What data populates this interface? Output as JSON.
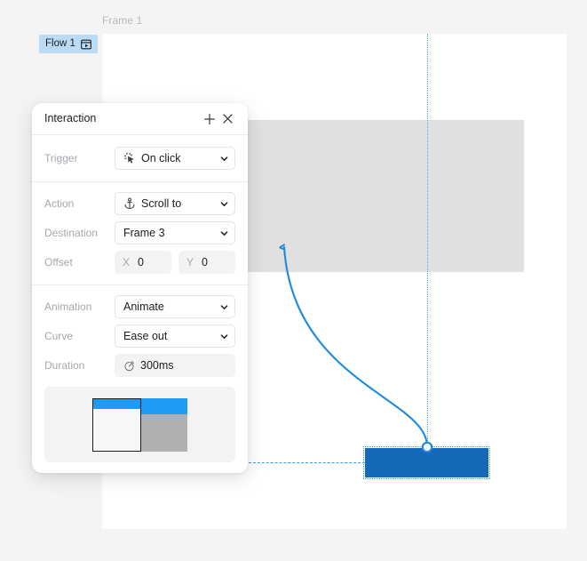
{
  "canvas": {
    "frame_label": "Frame 1",
    "flow_badge": {
      "label": "Flow 1",
      "icon": "flow-play-icon"
    },
    "selected_shape": {
      "name": "selected-rectangle",
      "fill": "#1668b8"
    },
    "colors": {
      "background": "#f4f4f5",
      "frame": "#ffffff",
      "inner_block": "#e0e0e0",
      "guide": "#3f9ae5",
      "connector": "#1e8ae0",
      "accent": "#1e9bf5"
    }
  },
  "panel": {
    "title": "Interaction",
    "add_label": "+",
    "close_label": "×",
    "trigger": {
      "label": "Trigger",
      "value": "On click",
      "icon": "click-cursor-icon"
    },
    "action": {
      "label": "Action",
      "value": "Scroll to",
      "icon": "anchor-icon"
    },
    "destination": {
      "label": "Destination",
      "value": "Frame 3"
    },
    "offset": {
      "label": "Offset",
      "x_axis": "X",
      "x_value": "0",
      "y_axis": "Y",
      "y_value": "0"
    },
    "animation": {
      "label": "Animation",
      "value": "Animate"
    },
    "curve": {
      "label": "Curve",
      "value": "Ease out"
    },
    "duration": {
      "label": "Duration",
      "value": "300ms",
      "icon": "stopwatch-icon"
    },
    "preview": {
      "name": "animation-preview"
    }
  }
}
